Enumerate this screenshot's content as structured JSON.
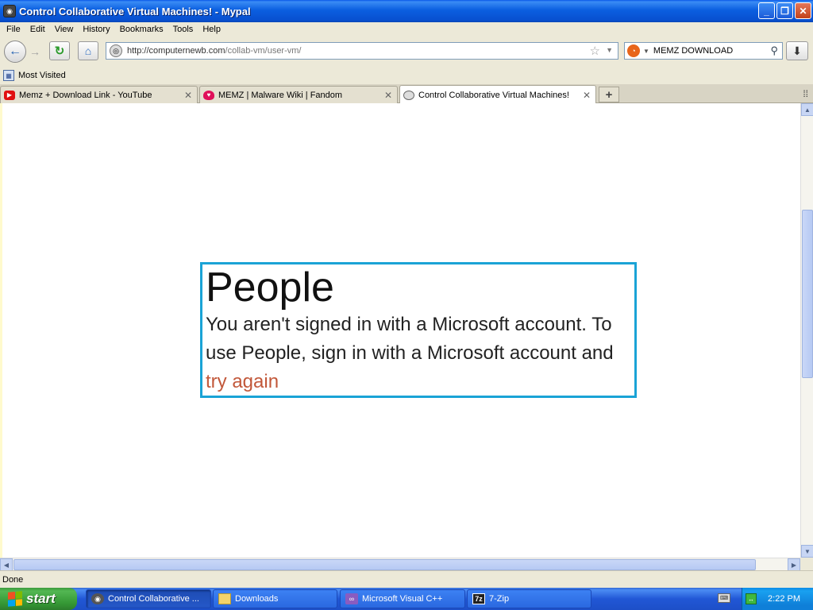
{
  "window": {
    "title": "Control Collaborative Virtual Machines! - Mypal"
  },
  "menu": [
    "File",
    "Edit",
    "View",
    "History",
    "Bookmarks",
    "Tools",
    "Help"
  ],
  "nav": {
    "url_host": "http://computernewb.com",
    "url_path": "/collab-vm/user-vm/",
    "search_query": "MEMZ DOWNLOAD"
  },
  "bookmarks": {
    "most_visited": "Most Visited"
  },
  "tabs": [
    {
      "label": "Memz + Download Link - YouTube",
      "favicon": "youtube-icon"
    },
    {
      "label": "MEMZ | Malware Wiki | Fandom",
      "favicon": "fandom-icon"
    },
    {
      "label": "Control Collaborative Virtual Machines!",
      "favicon": "collabvm-icon",
      "active": true
    }
  ],
  "page": {
    "heading": "People",
    "message": "You aren't signed in with a Microsoft account. To use People, sign in with a Microsoft account and",
    "link": "try again"
  },
  "status": {
    "text": "Done"
  },
  "taskbar": {
    "start": "start",
    "items": [
      {
        "label": "Control Collaborative ...",
        "icon": "firefox-icon",
        "active": true
      },
      {
        "label": "Downloads",
        "icon": "folder-icon"
      },
      {
        "label": "Microsoft Visual C++",
        "icon": "visual-cpp-icon"
      },
      {
        "label": "7-Zip",
        "icon": "7zip-icon"
      }
    ],
    "clock": "2:22 PM"
  },
  "colors": {
    "box_border": "#1aa3d6",
    "link": "#c2583a",
    "titlebar": "#0b5fe0"
  }
}
